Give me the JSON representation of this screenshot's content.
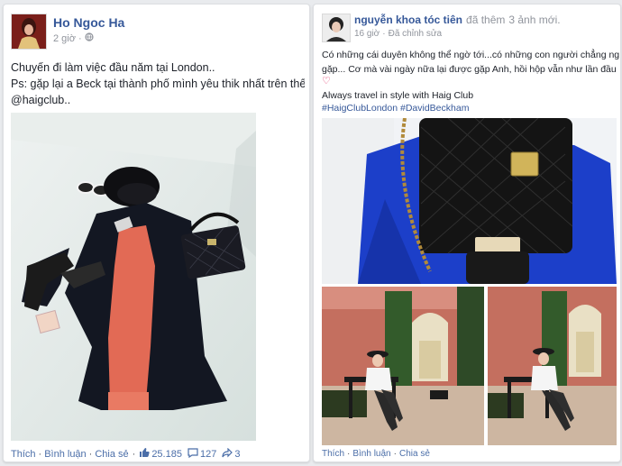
{
  "post_left": {
    "author": "Ho Ngoc Ha",
    "time": "2 giờ",
    "lines": [
      "Chuyến đi làm việc đầu năm tại London..",
      "Ps: gặp lại a Beck tại thành phố mình yêu thik nhất trên thế",
      "@haigclub.."
    ],
    "actions": {
      "like": "Thích",
      "comment": "Bình luận",
      "share": "Chia sẻ"
    },
    "likes": "25.185",
    "comments": "127",
    "shares": "3"
  },
  "post_right": {
    "author": "nguyễn khoa tóc tiên",
    "added": "đã thêm",
    "added_count": "3 ảnh mới.",
    "time": "16 giờ",
    "edited": "Đã chỉnh sửa",
    "lines": [
      "Có những cái duyên không thể ngờ tới...có những con người chẳng ng",
      "gặp... Cơ mà vài ngày nữa lại được gặp Anh, hồi hộp vẫn như lần đầu"
    ],
    "heart": "♡",
    "line3": "Always travel in style with Haig Club",
    "hashtags": "#HaigClubLondon #DavidBeckham",
    "actions": {
      "like": "Thích",
      "comment": "Bình luận",
      "share": "Chia sẻ"
    }
  },
  "colors": {
    "link": "#365899",
    "meta": "#90949c",
    "border": "#dddfe2"
  }
}
